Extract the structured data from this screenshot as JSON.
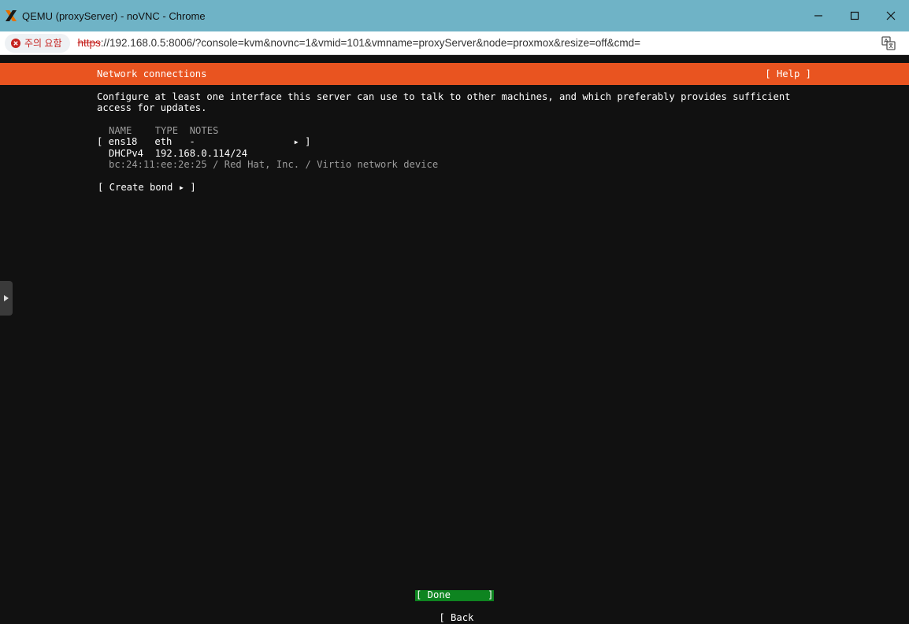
{
  "window": {
    "title": "QEMU (proxyServer) - noVNC - Chrome",
    "icon": "proxmox-x-icon",
    "controls": [
      "minimize-icon",
      "maximize-icon",
      "close-icon"
    ]
  },
  "addressbar": {
    "security_label": "주의 요함",
    "url_scheme": "https",
    "url_rest": "://192.168.0.5:8006/?console=kvm&novnc=1&vmid=101&vmname=proxyServer&node=proxmox&resize=off&cmd=",
    "security_color": "#c5221f"
  },
  "console": {
    "header": {
      "title": "Network connections",
      "help": "[ Help ]",
      "color": "#e95420"
    },
    "intro_line1": "Configure at least one interface this server can use to talk to other machines, and which preferably provides sufficient",
    "intro_line2": "access for updates.",
    "table": {
      "header": "NAME    TYPE  NOTES",
      "iface_row": "[ ens18   eth   -                 ▸ ]",
      "dhcp_row": "DHCPv4  192.168.0.114/24",
      "mac_row": "bc:24:11:ee:2e:25 / Red Hat, Inc. / Virtio network device"
    },
    "create_bond": "[ Create bond ▸ ]",
    "done_open": "[ Done",
    "done_close": "]",
    "back_open": "[ Back",
    "back_close": "]",
    "done_color": "#0e8420"
  }
}
